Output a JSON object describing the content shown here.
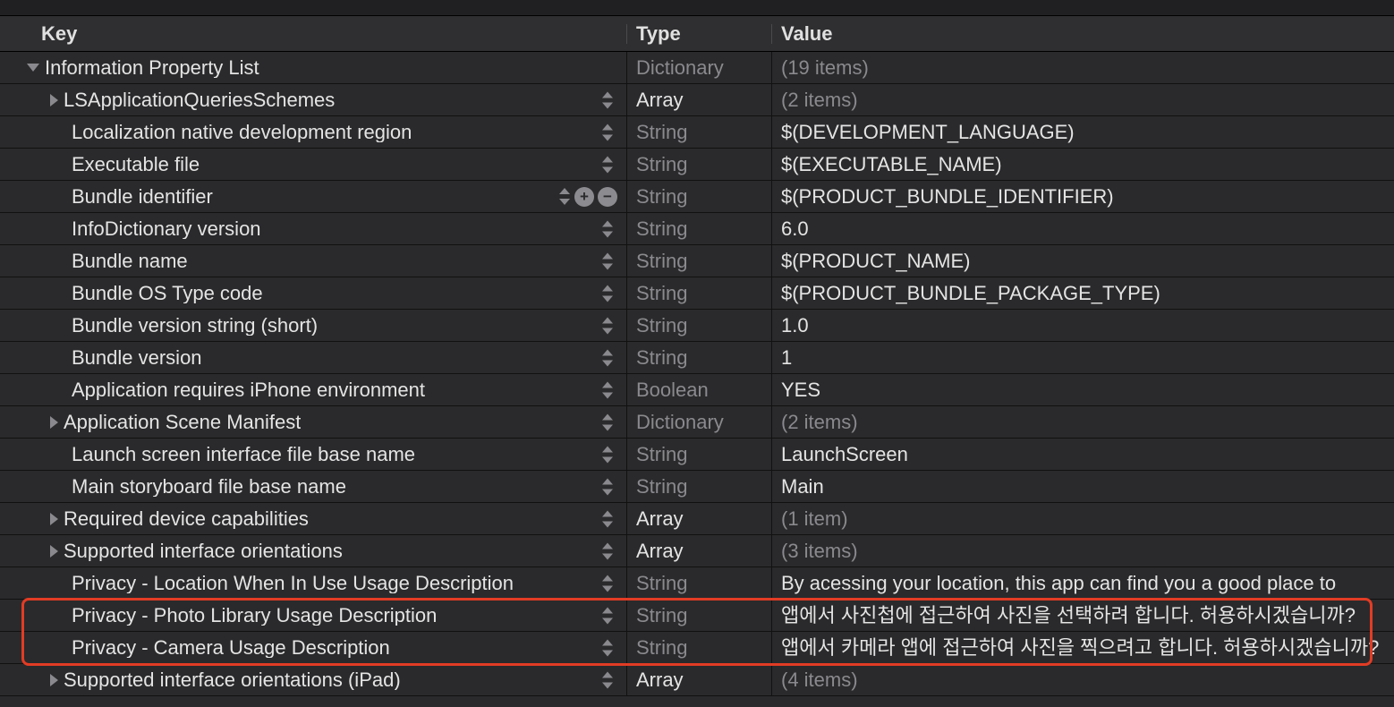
{
  "header": {
    "key": "Key",
    "type": "Type",
    "value": "Value"
  },
  "root": {
    "key": "Information Property List",
    "type": "Dictionary",
    "value": "(19 items)"
  },
  "rows": [
    {
      "key": "LSApplicationQueriesSchemes",
      "type": "Array",
      "value": "(2 items)",
      "typeStrong": true,
      "dimVal": true,
      "disclosure": "right",
      "indent": 1
    },
    {
      "key": "Localization native development region",
      "type": "String",
      "value": "$(DEVELOPMENT_LANGUAGE)",
      "indent": 2
    },
    {
      "key": "Executable file",
      "type": "String",
      "value": "$(EXECUTABLE_NAME)",
      "indent": 2
    },
    {
      "key": "Bundle identifier",
      "type": "String",
      "value": "$(PRODUCT_BUNDLE_IDENTIFIER)",
      "indent": 2,
      "selectedControls": true
    },
    {
      "key": "InfoDictionary version",
      "type": "String",
      "value": "6.0",
      "indent": 2
    },
    {
      "key": "Bundle name",
      "type": "String",
      "value": "$(PRODUCT_NAME)",
      "indent": 2
    },
    {
      "key": "Bundle OS Type code",
      "type": "String",
      "value": "$(PRODUCT_BUNDLE_PACKAGE_TYPE)",
      "indent": 2
    },
    {
      "key": "Bundle version string (short)",
      "type": "String",
      "value": "1.0",
      "indent": 2
    },
    {
      "key": "Bundle version",
      "type": "String",
      "value": "1",
      "indent": 2
    },
    {
      "key": "Application requires iPhone environment",
      "type": "Boolean",
      "value": "YES",
      "indent": 2
    },
    {
      "key": "Application Scene Manifest",
      "type": "Dictionary",
      "value": "(2 items)",
      "dimVal": true,
      "disclosure": "right",
      "indent": 1
    },
    {
      "key": "Launch screen interface file base name",
      "type": "String",
      "value": "LaunchScreen",
      "indent": 2
    },
    {
      "key": "Main storyboard file base name",
      "type": "String",
      "value": "Main",
      "indent": 2
    },
    {
      "key": "Required device capabilities",
      "type": "Array",
      "value": "(1 item)",
      "typeStrong": true,
      "dimVal": true,
      "disclosure": "right",
      "indent": 1
    },
    {
      "key": "Supported interface orientations",
      "type": "Array",
      "value": "(3 items)",
      "typeStrong": true,
      "dimVal": true,
      "disclosure": "right",
      "indent": 1
    },
    {
      "key": "Privacy - Location When In Use Usage Description",
      "type": "String",
      "value": "By acessing your location, this app can find you a good place to",
      "indent": 2
    },
    {
      "key": "Privacy - Photo Library Usage Description",
      "type": "String",
      "value": "앱에서 사진첩에 접근하여 사진을 선택하려 합니다. 허용하시겠습니까?",
      "indent": 2
    },
    {
      "key": "Privacy - Camera Usage Description",
      "type": "String",
      "value": "앱에서 카메라 앱에 접근하여 사진을 찍으려고 합니다. 허용하시겠습니까?",
      "indent": 2
    },
    {
      "key": "Supported interface orientations (iPad)",
      "type": "Array",
      "value": "(4 items)",
      "typeStrong": true,
      "dimVal": true,
      "disclosure": "right",
      "indent": 1
    }
  ],
  "icons": {
    "plus": "+",
    "minus": "−"
  },
  "highlight": {
    "fromRow": 16,
    "toRow": 17
  }
}
